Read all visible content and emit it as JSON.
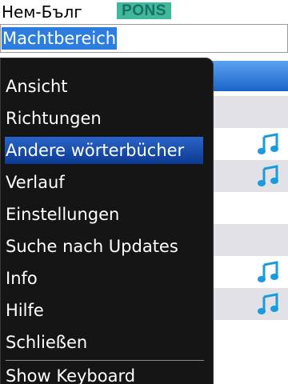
{
  "header": {
    "language_pair": "Нем-Бълг",
    "logo_text": "PONS"
  },
  "search": {
    "value": "Machtbereich"
  },
  "list": {
    "rows": [
      {
        "alt": true,
        "audio": false
      },
      {
        "alt": false,
        "audio": true
      },
      {
        "alt": true,
        "audio": true
      },
      {
        "alt": false,
        "audio": false
      },
      {
        "alt": true,
        "audio": false
      },
      {
        "alt": false,
        "audio": true
      },
      {
        "alt": true,
        "audio": true
      },
      {
        "alt": false,
        "audio": false
      }
    ]
  },
  "menu": {
    "items": [
      {
        "label": "Ansicht"
      },
      {
        "label": "Richtungen"
      },
      {
        "label": "Andere wörterbücher",
        "selected": true
      },
      {
        "label": "Verlauf"
      },
      {
        "label": "Einstellungen"
      },
      {
        "label": "Suche nach Updates"
      },
      {
        "label": "Info"
      },
      {
        "label": "Hilfe"
      },
      {
        "label": "Schließen"
      },
      {
        "label": "Show Keyboard"
      }
    ]
  },
  "colors": {
    "accent_blue": "#2d7de0",
    "menu_bg": "#151515",
    "logo_green": "#3fb89c",
    "audio_icon": "#1a9be0"
  },
  "icons": {
    "audio": "music-note-icon"
  }
}
